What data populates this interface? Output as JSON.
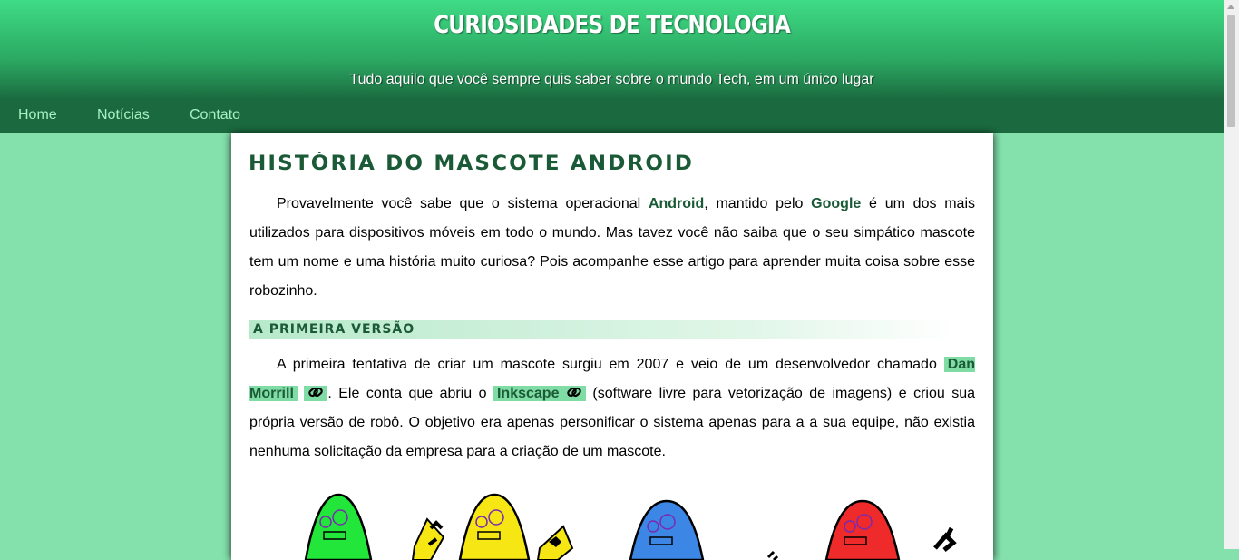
{
  "header": {
    "title": "CURIOSIDADES DE TECNOLOGIA",
    "subtitle": "Tudo aquilo que você sempre quis saber sobre o mundo Tech, em um único lugar"
  },
  "nav": {
    "home": "Home",
    "news": "Notícias",
    "contact": "Contato"
  },
  "article": {
    "title": "HISTÓRIA DO MASCOTE ANDROID",
    "intro": {
      "t1": "Provavelmente você sabe que o sistema operacional ",
      "android": "Android",
      "t2": ", mantido pelo ",
      "google": "Google",
      "t3": " é um dos mais utilizados para dispositivos móveis em todo o mundo. Mas tavez você não saiba que o seu simpático mascote tem um nome e uma história muito curiosa? Pois acompanhe esse artigo para aprender muita coisa sobre esse robozinho."
    },
    "section1": {
      "heading": "A PRIMEIRA VERSÃO",
      "t1": "A primeira tentativa de criar um mascote surgiu em 2007 e veio de um desenvolvedor chamado ",
      "dan": "Dan Morrill",
      "t2": ". Ele conta que abriu o ",
      "inkscape": "Inkscape",
      "t3": " (software livre para vetorização de imagens) e criou sua própria versão de robô. O objetivo era apenas personificar o sistema apenas para a a sua equipe, não existia nenhuma solicitação da empresa para a criação de um mascote."
    }
  },
  "icons": {
    "link": "link-icon"
  },
  "colors": {
    "header_top": "#3fdc86",
    "header_bottom": "#1b6a3f",
    "background": "#84e1ac",
    "highlight": "#7fdca5",
    "heading": "#1b5a36"
  }
}
